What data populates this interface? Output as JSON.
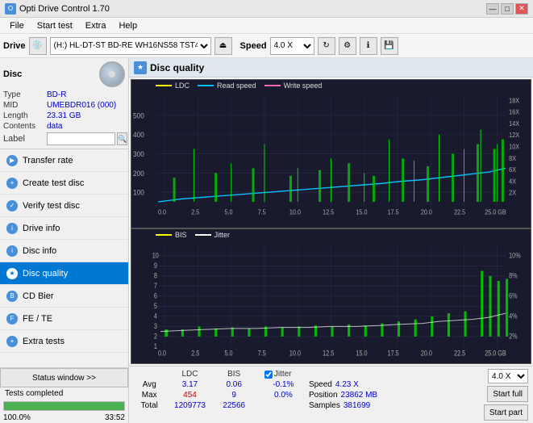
{
  "titlebar": {
    "title": "Opti Drive Control 1.70",
    "minimize": "—",
    "maximize": "□",
    "close": "✕"
  },
  "menubar": {
    "items": [
      "File",
      "Start test",
      "Extra",
      "Help"
    ]
  },
  "toolbar": {
    "drive_label": "Drive",
    "drive_value": "(H:) HL-DT-ST BD-RE  WH16NS58 TST4",
    "speed_label": "Speed",
    "speed_value": "4.0 X"
  },
  "disc": {
    "title": "Disc",
    "type_label": "Type",
    "type_value": "BD-R",
    "mid_label": "MID",
    "mid_value": "UMEBDR016 (000)",
    "length_label": "Length",
    "length_value": "23.31 GB",
    "contents_label": "Contents",
    "contents_value": "data",
    "label_label": "Label",
    "label_value": ""
  },
  "nav": {
    "items": [
      {
        "id": "transfer-rate",
        "label": "Transfer rate",
        "active": false
      },
      {
        "id": "create-test-disc",
        "label": "Create test disc",
        "active": false
      },
      {
        "id": "verify-test-disc",
        "label": "Verify test disc",
        "active": false
      },
      {
        "id": "drive-info",
        "label": "Drive info",
        "active": false
      },
      {
        "id": "disc-info",
        "label": "Disc info",
        "active": false
      },
      {
        "id": "disc-quality",
        "label": "Disc quality",
        "active": true
      },
      {
        "id": "cd-bier",
        "label": "CD Bier",
        "active": false
      },
      {
        "id": "fe-te",
        "label": "FE / TE",
        "active": false
      },
      {
        "id": "extra-tests",
        "label": "Extra tests",
        "active": false
      }
    ]
  },
  "status": {
    "window_btn": "Status window >>",
    "text": "Tests completed",
    "progress": 100,
    "time": "33:52"
  },
  "quality": {
    "title": "Disc quality",
    "icon": "★",
    "legend_top": [
      {
        "label": "LDC",
        "color": "#ffff00"
      },
      {
        "label": "Read speed",
        "color": "#00bfff"
      },
      {
        "label": "Write speed",
        "color": "#ff69b4"
      }
    ],
    "legend_bottom": [
      {
        "label": "BIS",
        "color": "#ffff00"
      },
      {
        "label": "Jitter",
        "color": "#ffffff"
      }
    ],
    "top_chart": {
      "y_max": 500,
      "y_ticks": [
        100,
        200,
        300,
        400,
        500
      ],
      "y_right_ticks": [
        "18X",
        "16X",
        "14X",
        "12X",
        "10X",
        "8X",
        "6X",
        "4X",
        "2X"
      ],
      "x_ticks": [
        "0.0",
        "2.5",
        "5.0",
        "7.5",
        "10.0",
        "12.5",
        "15.0",
        "17.5",
        "20.0",
        "22.5",
        "25.0 GB"
      ]
    },
    "bottom_chart": {
      "y_max": 10,
      "y_ticks": [
        1,
        2,
        3,
        4,
        5,
        6,
        7,
        8,
        9,
        10
      ],
      "y_right_ticks": [
        "10%",
        "8%",
        "6%",
        "4%",
        "2%"
      ],
      "x_ticks": [
        "0.0",
        "2.5",
        "5.0",
        "7.5",
        "10.0",
        "12.5",
        "15.0",
        "17.5",
        "20.0",
        "22.5",
        "25.0 GB"
      ]
    }
  },
  "stats": {
    "columns": [
      "",
      "LDC",
      "BIS",
      "",
      "Jitter",
      "Speed",
      "",
      ""
    ],
    "rows": [
      {
        "label": "Avg",
        "ldc": "3.17",
        "bis": "0.06",
        "jitter": "-0.1%",
        "speed_label": "Speed",
        "speed_val": "4.23 X"
      },
      {
        "label": "Max",
        "ldc": "454",
        "bis": "9",
        "jitter": "0.0%",
        "speed_label": "Position",
        "speed_val": "23862 MB"
      },
      {
        "label": "Total",
        "ldc": "1209773",
        "bis": "22566",
        "jitter": "",
        "speed_label": "Samples",
        "speed_val": "381699"
      }
    ],
    "jitter_checked": true,
    "jitter_label": "Jitter",
    "speed_dropdown": "4.0 X",
    "start_full_label": "Start full",
    "start_part_label": "Start part"
  }
}
